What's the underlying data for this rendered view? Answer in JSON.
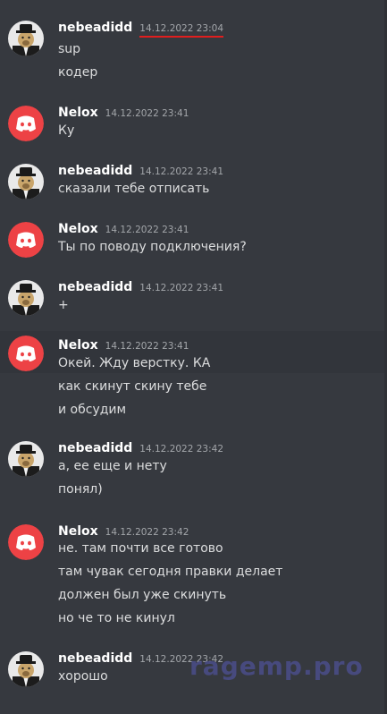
{
  "messages": [
    {
      "author": "nebeadidd",
      "avatar": "dog-hat-avatar",
      "time": "14.12.2022 23:04",
      "lines": [
        "sup",
        "кодер"
      ]
    },
    {
      "author": "Nelox",
      "avatar": "discord-avatar",
      "time": "14.12.2022 23:41",
      "lines": [
        "Ку"
      ]
    },
    {
      "author": "nebeadidd",
      "avatar": "dog-hat-avatar",
      "time": "14.12.2022 23:41",
      "lines": [
        "сказали тебе отписать"
      ]
    },
    {
      "author": "Nelox",
      "avatar": "discord-avatar",
      "time": "14.12.2022 23:41",
      "lines": [
        "Ты по поводу подключения?"
      ]
    },
    {
      "author": "nebeadidd",
      "avatar": "dog-hat-avatar",
      "time": "14.12.2022 23:41",
      "lines": [
        "+"
      ]
    },
    {
      "author": "Nelox",
      "avatar": "discord-avatar",
      "time": "14.12.2022 23:41",
      "lines": [
        "Окей. Жду верстку. КА",
        "как скинут скину тебе",
        "и обсудим"
      ]
    },
    {
      "author": "nebeadidd",
      "avatar": "dog-hat-avatar",
      "time": "14.12.2022 23:42",
      "lines": [
        "а, ее еще и нету",
        "понял)"
      ]
    },
    {
      "author": "Nelox",
      "avatar": "discord-avatar",
      "time": "14.12.2022 23:42",
      "lines": [
        "не. там почти все готово",
        "там чувак сегодня правки делает",
        "должен был уже скинуть",
        "но че то не кинул"
      ]
    },
    {
      "author": "nebeadidd",
      "avatar": "dog-hat-avatar",
      "time": "14.12.2022 23:42",
      "lines": [
        "хорошо"
      ]
    }
  ],
  "watermark": "ragemp.pro",
  "colors": {
    "background": "#36393f",
    "discord_red": "#ed4245",
    "highlight_underline": "#e01e1e"
  }
}
